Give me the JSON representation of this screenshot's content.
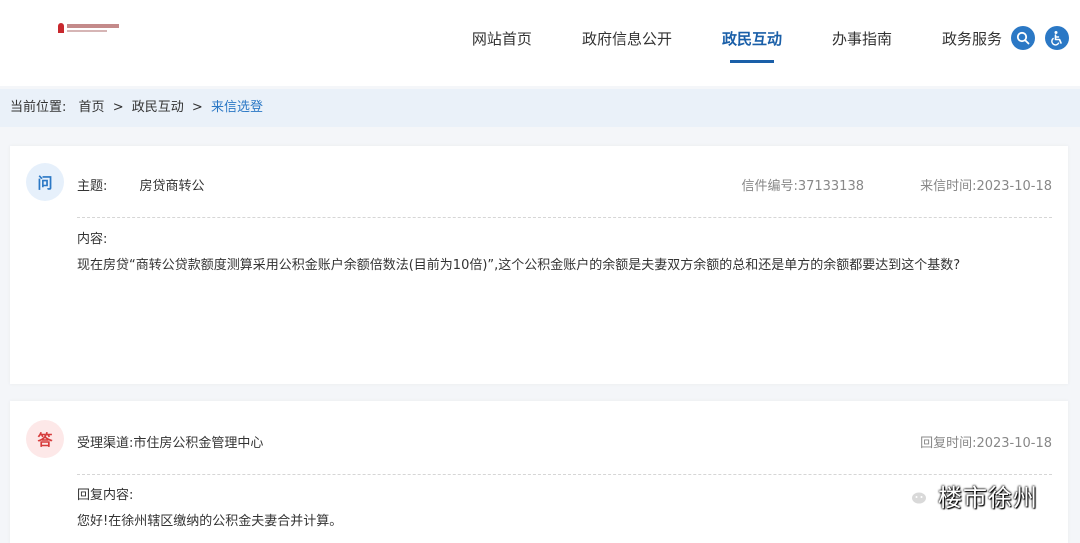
{
  "nav": {
    "items": [
      "网站首页",
      "政府信息公开",
      "政民互动",
      "办事指南",
      "政务服务"
    ],
    "active_index": 2,
    "icons": [
      "search-icon",
      "accessibility-icon"
    ]
  },
  "breadcrumb": {
    "label": "当前位置:",
    "items": [
      "首页",
      "政民互动"
    ],
    "separator": ">",
    "current": "来信选登"
  },
  "question": {
    "badge": "问",
    "subject_label": "主题:",
    "subject": "房贷商转公",
    "letter_no": "信件编号:37133138",
    "letter_time": "来信时间:2023-10-18",
    "content_label": "内容:",
    "content": "现在房贷“商转公贷款额度测算采用公积金账户余额倍数法(目前为10倍)”,这个公积金账户的余额是夫妻双方余额的总和还是单方的余额都要达到这个基数?"
  },
  "answer": {
    "badge": "答",
    "channel": "受理渠道:市住房公积金管理中心",
    "reply_time": "回复时间:2023-10-18",
    "content_label": "回复内容:",
    "content": "您好!在徐州辖区缴纳的公积金夫妻合并计算。"
  },
  "watermark": {
    "text": "楼市徐州",
    "icon": "wechat-icon"
  },
  "colors": {
    "accent": "#1a5fa8",
    "answer_badge": "#d63b3b",
    "breadcrumb_bg": "#eaf1f9"
  }
}
